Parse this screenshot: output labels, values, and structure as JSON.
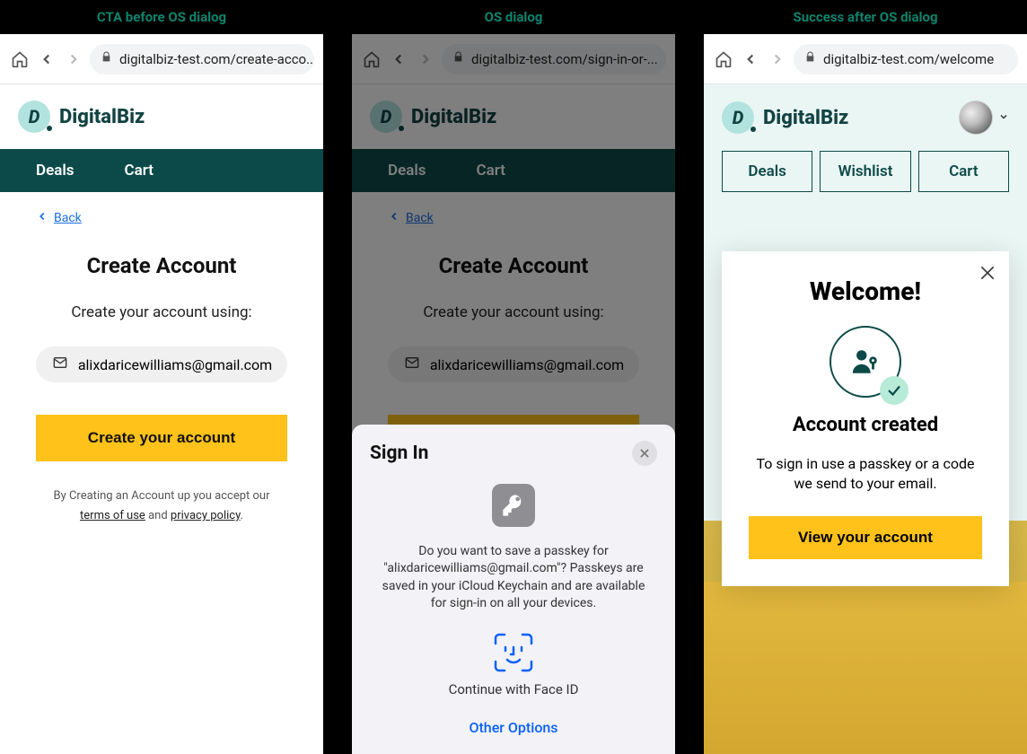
{
  "captions": {
    "s1": "CTA before OS dialog",
    "s2": "OS dialog",
    "s3": "Success after OS dialog"
  },
  "urls": {
    "s1": "digitalbiz-test.com/create-acco...",
    "s2": "digitalbiz-test.com/sign-in-or-...",
    "s3": "digitalbiz-test.com/welcome"
  },
  "brand": {
    "initial": "D",
    "name": "DigitalBiz"
  },
  "nav": {
    "deals": "Deals",
    "cart": "Cart",
    "wishlist": "Wishlist"
  },
  "createAccount": {
    "back": "Back",
    "title": "Create Account",
    "subtitle": "Create your account using:",
    "email": "alixdaricewilliams@gmail.com",
    "cta": "Create your account",
    "legalPrefix": "By Creating an Account up you accept our",
    "terms": "terms of use",
    "and": "and",
    "privacy": "privacy policy",
    "period": "."
  },
  "iosDialog": {
    "title": "Sign In",
    "body": "Do you want to save a passkey for \"alixdaricewilliams@gmail.com\"? Passkeys are saved in your iCloud Keychain and are available for sign-in on all your devices.",
    "faceid": "Continue with Face ID",
    "other": "Other Options"
  },
  "welcome": {
    "title": "Welcome!",
    "created": "Account created",
    "body": "To sign in use a passkey or a code we send to your email.",
    "cta": "View your account"
  }
}
